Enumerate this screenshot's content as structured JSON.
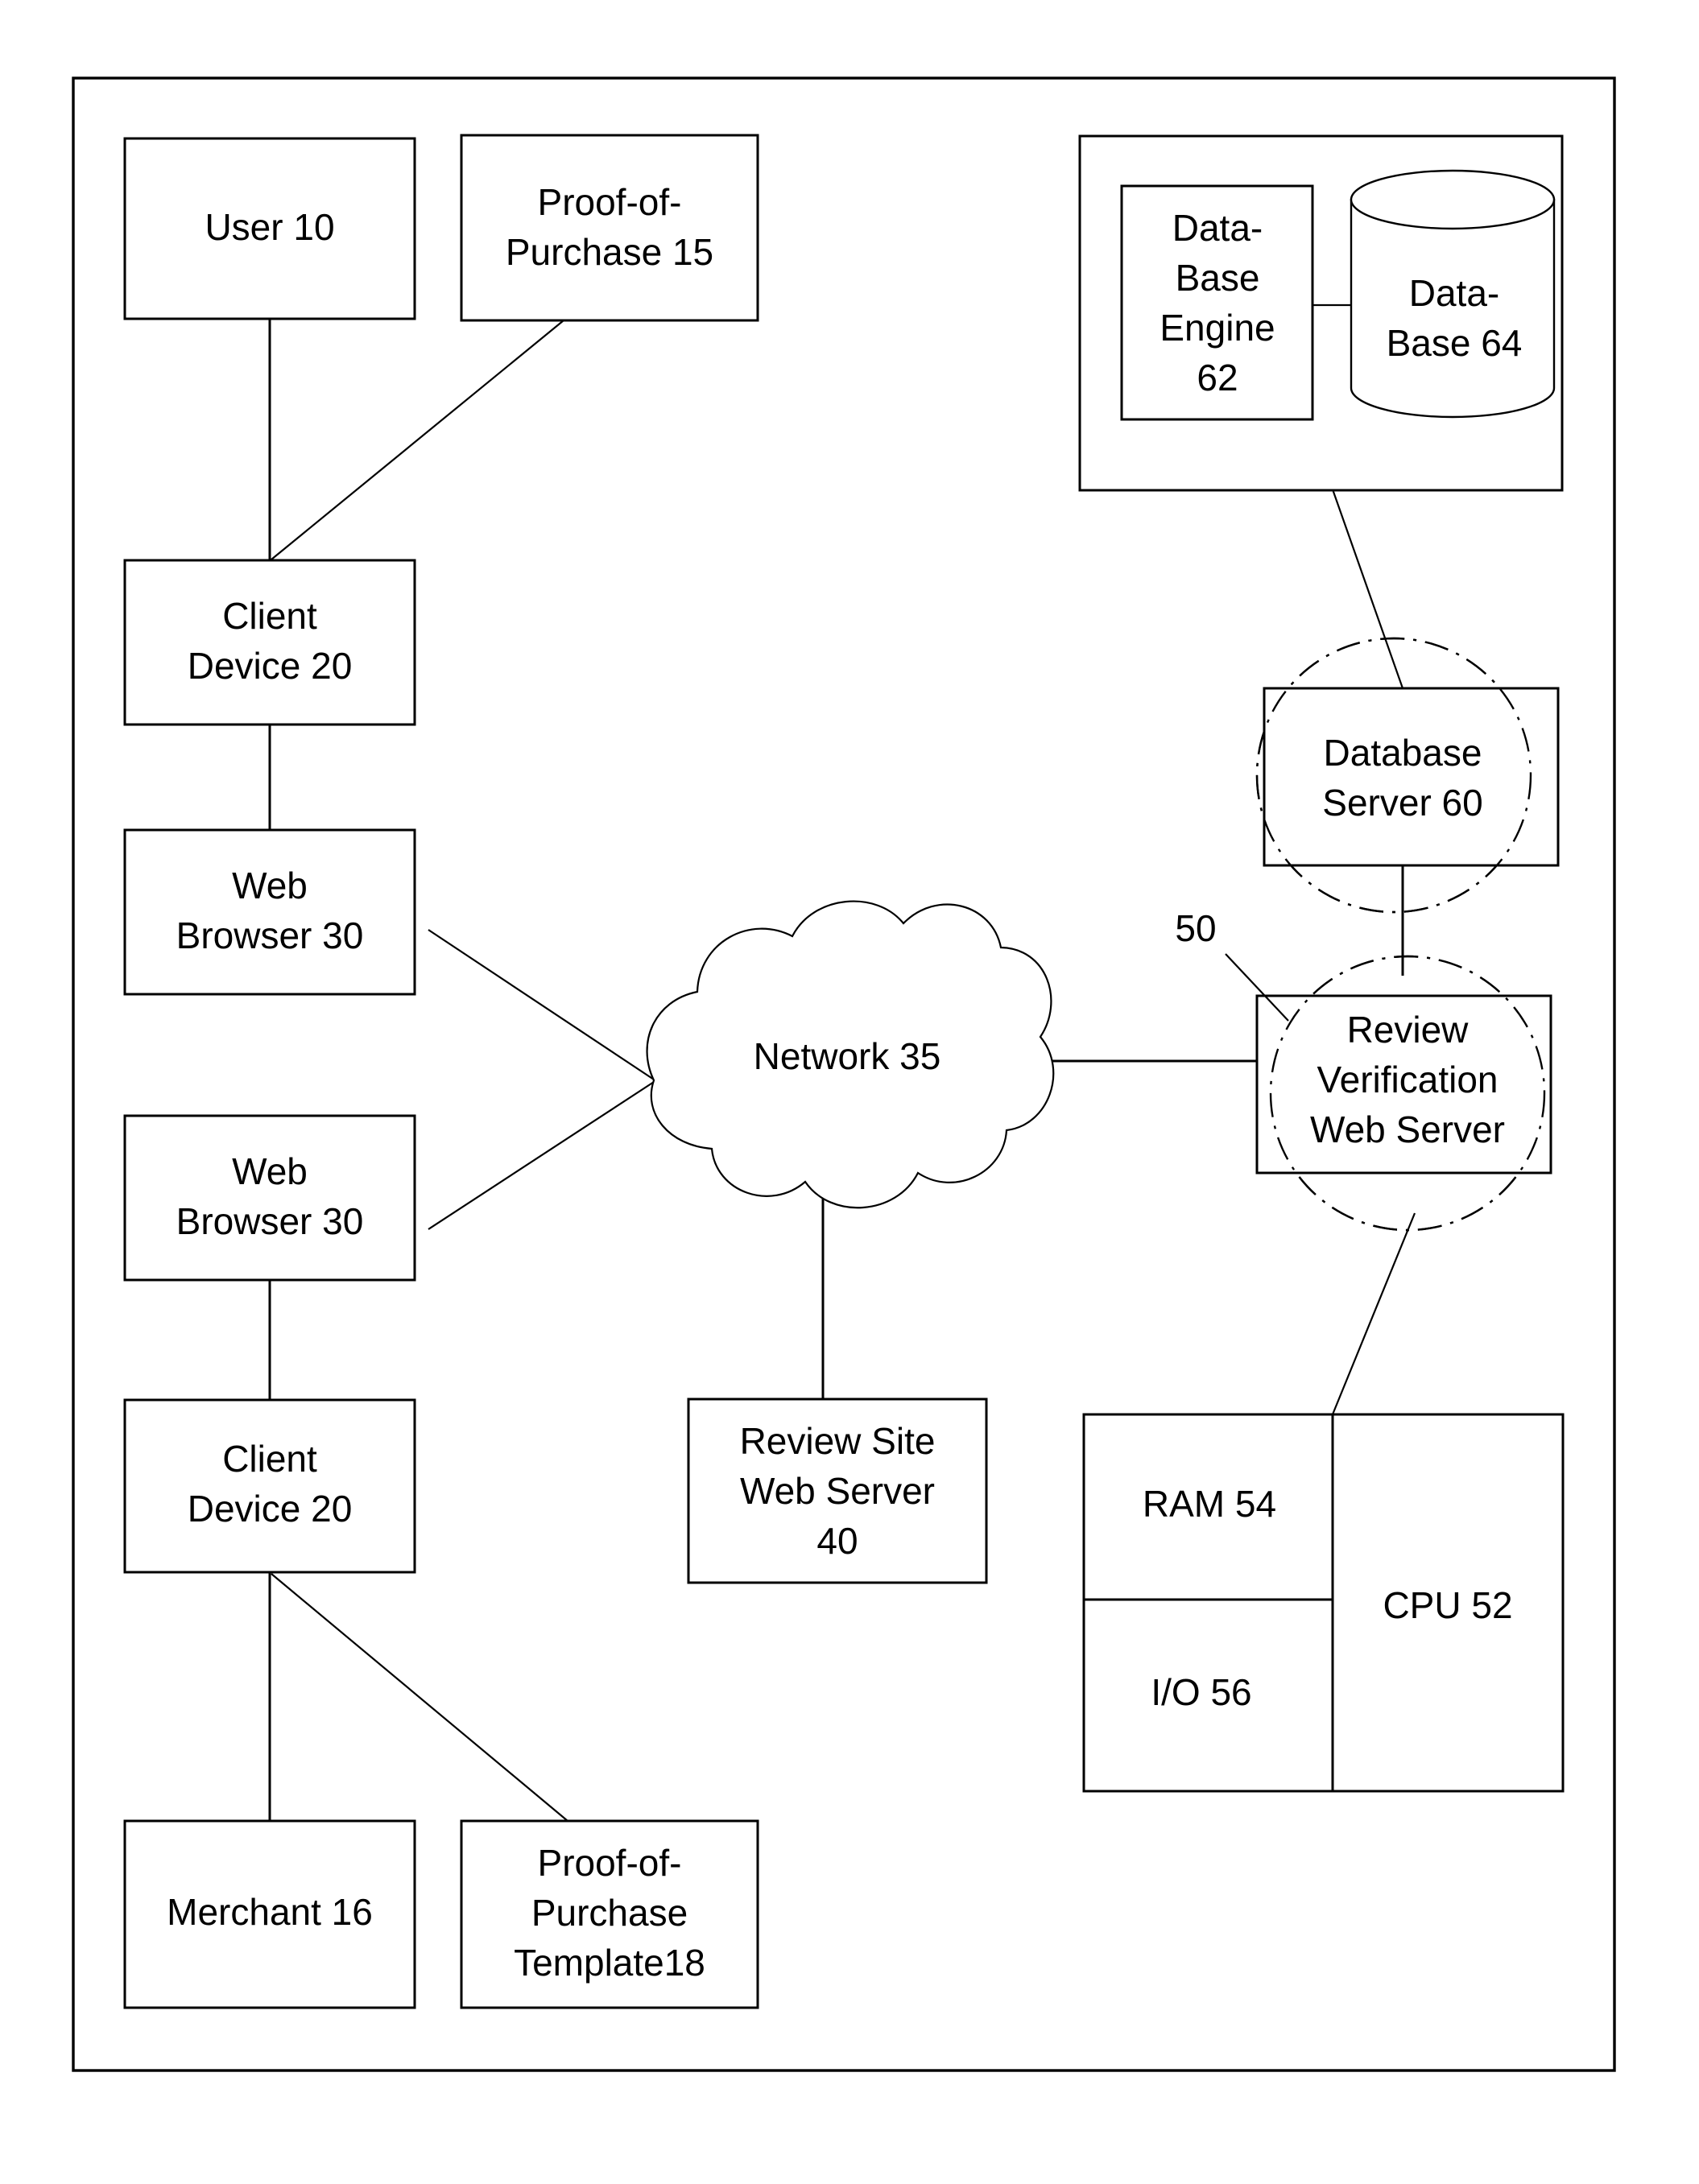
{
  "figure": {
    "type": "system-architecture-block-diagram",
    "background_color": "#ffffff",
    "line_color": "#000000"
  },
  "nodes": {
    "user": {
      "label": "User 10",
      "ref": "10"
    },
    "proof_of_purchase": {
      "line1": "Proof-of-",
      "line2": "Purchase 15",
      "ref": "15"
    },
    "client_device_top": {
      "line1": "Client",
      "line2": "Device 20",
      "ref": "20"
    },
    "web_browser_top": {
      "line1": "Web",
      "line2": "Browser 30",
      "ref": "30"
    },
    "web_browser_bottom": {
      "line1": "Web",
      "line2": "Browser 30",
      "ref": "30"
    },
    "client_device_bottom": {
      "line1": "Client",
      "line2": "Device 20",
      "ref": "20"
    },
    "merchant": {
      "label": "Merchant 16",
      "ref": "16"
    },
    "proof_of_purchase_template": {
      "line1": "Proof-of-",
      "line2": "Purchase",
      "line3": "Template18",
      "ref": "18"
    },
    "network": {
      "label": "Network 35",
      "ref": "35"
    },
    "review_site_web_server": {
      "line1": "Review Site",
      "line2": "Web Server",
      "line3": "40",
      "ref": "40"
    },
    "database_engine": {
      "line1": "Data-",
      "line2": "Base",
      "line3": "Engine",
      "line4": "62",
      "ref": "62"
    },
    "database_cylinder": {
      "line1": "Data-",
      "line2": "Base 64",
      "ref": "64"
    },
    "database_server": {
      "line1": "Database",
      "line2": "Server 60",
      "ref": "60"
    },
    "review_verification_web_server": {
      "line1": "Review",
      "line2": "Verification",
      "line3": "Web Server",
      "ref": "50"
    },
    "system_callout": {
      "label": "50"
    },
    "ram": {
      "label": "RAM 54",
      "ref": "54"
    },
    "io": {
      "label": "I/O 56",
      "ref": "56"
    },
    "cpu": {
      "label": "CPU 52",
      "ref": "52"
    }
  }
}
